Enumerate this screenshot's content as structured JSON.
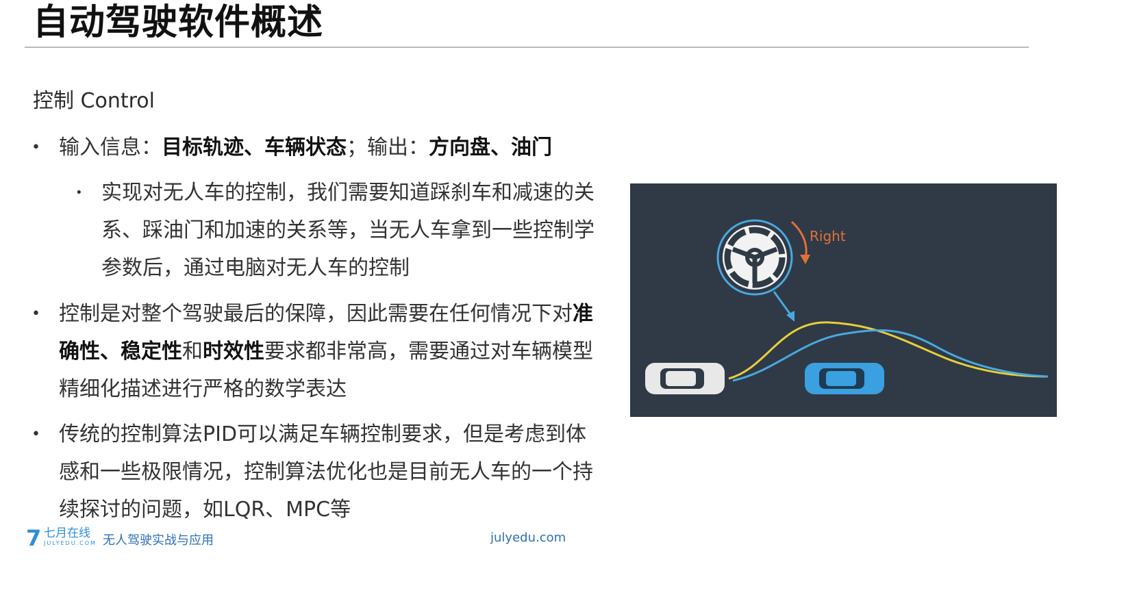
{
  "slide": {
    "title": "自动驾驶软件概述",
    "section": "控制 Control"
  },
  "bullets": [
    {
      "level": 1,
      "runs": [
        {
          "t": "输入信息：",
          "b": false
        },
        {
          "t": "目标轨迹、车辆状态",
          "b": true
        },
        {
          "t": "；输出：",
          "b": false
        },
        {
          "t": "方向盘、油门",
          "b": true
        }
      ]
    },
    {
      "level": 2,
      "lines": [
        "实现对无人车的控制，我们需要知道踩刹车和减速的关",
        "系、踩油门和加速的关系等，当无人车拿到一些控制学",
        "参数后，通过电脑对无人车的控制"
      ]
    },
    {
      "level": 1,
      "line1": [
        {
          "t": "控制是对整个驾驶最后的保障，因此需要在任何情况下对",
          "b": false
        },
        {
          "t": "准",
          "b": true
        }
      ],
      "line2": [
        {
          "t": "确性、稳定性",
          "b": true
        },
        {
          "t": "和",
          "b": false
        },
        {
          "t": "时效性",
          "b": true
        },
        {
          "t": "要求都非常高，需要通过对车辆模型",
          "b": false
        }
      ],
      "line3": "精细化描述进行严格的数学表达"
    },
    {
      "level": 1,
      "lines": [
        "传统的控制算法PID可以满足车辆控制要求，但是考虑到体",
        "感和一些极限情况，控制算法优化也是目前无人车的一个持",
        "续探讨的问题，如LQR、MPC等"
      ]
    }
  ],
  "figure": {
    "direction_label": "Right",
    "colors": {
      "background": "#2f3a46",
      "yellow_path": "#e8cf3a",
      "blue_path": "#4aa8e0",
      "arrow_orange": "#e0703a",
      "blue_car": "#3aa0e0",
      "white_car": "#e8e8e8"
    }
  },
  "footer": {
    "logo_mark": "7",
    "logo_cn": "七月在线",
    "logo_en": "JULYEDU.COM",
    "course": "无人驾驶实战与应用",
    "site": "julyedu.com"
  }
}
